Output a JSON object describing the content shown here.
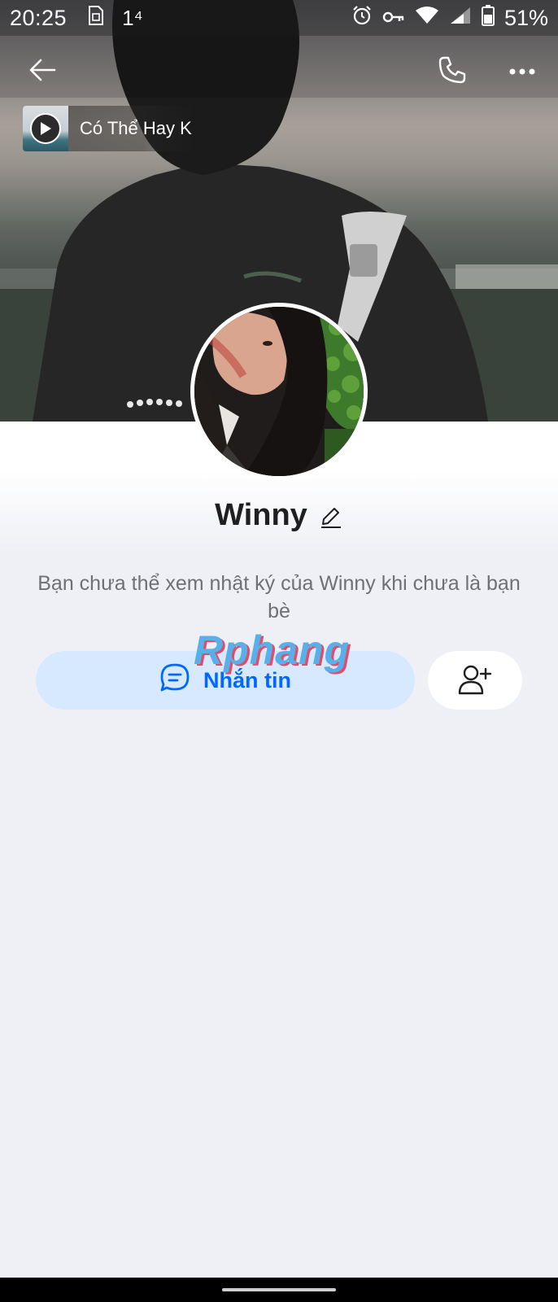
{
  "status_bar": {
    "time": "20:25",
    "indicator": "1⁴",
    "battery": "51%",
    "icons": [
      "sim-card-icon",
      "alarm-icon",
      "vpn-key-icon",
      "wifi-icon",
      "signal-icon",
      "battery-icon"
    ]
  },
  "app_bar": {
    "icons": [
      "back-arrow-icon",
      "phone-icon",
      "more-dots-icon"
    ]
  },
  "music": {
    "title": "Có Thể Hay K",
    "icon": "play-icon"
  },
  "profile": {
    "name": "Winny",
    "edit_icon": "pencil-icon",
    "info": "Bạn chưa thể xem nhật ký của Winny khi chưa là bạn bè"
  },
  "watermark": "Rphang",
  "actions": {
    "message_label": "Nhắn tin",
    "message_icon": "chat-bubble-icon",
    "add_friend_icon": "add-user-icon"
  },
  "colors": {
    "accent": "#0068ff",
    "message_button_bg": "#d6e9ff",
    "page_bg": "#eff0f5",
    "name_text": "#1f1f1f",
    "muted_text": "#6e7075"
  }
}
